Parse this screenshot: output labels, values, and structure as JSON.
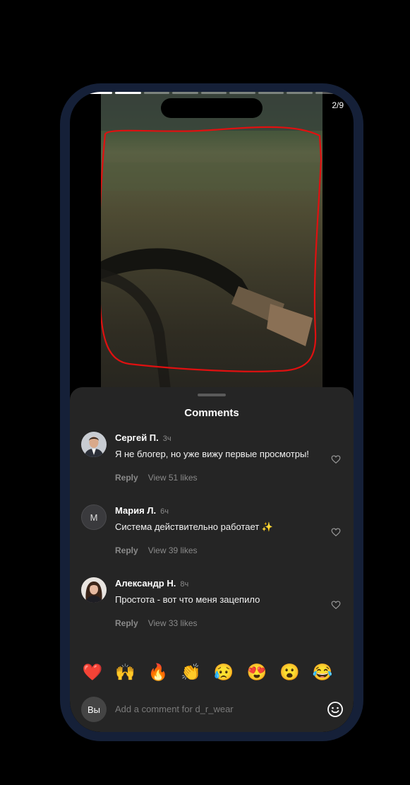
{
  "story": {
    "counter": "2/9",
    "segments": 9,
    "current": 2
  },
  "sheet": {
    "title": "Comments"
  },
  "comments": [
    {
      "name": "Сергей П.",
      "time": "3ч",
      "text": "Я не блогер, но уже вижу первые просмотры!",
      "reply": "Reply",
      "likes": "View 51 likes",
      "avatar": "man-photo"
    },
    {
      "name": "Мария Л.",
      "time": "6ч",
      "text": "Система действительно работает ✨",
      "reply": "Reply",
      "likes": "View 39 likes",
      "avatar_letter": "М"
    },
    {
      "name": "Александр Н.",
      "time": "8ч",
      "text": "Простота - вот что меня зацепило",
      "reply": "Reply",
      "likes": "View 33 likes",
      "avatar": "woman-photo"
    }
  ],
  "emojis": [
    "❤️",
    "🙌",
    "🔥",
    "👏",
    "😥",
    "😍",
    "😮",
    "😂"
  ],
  "composer": {
    "avatar": "Вы",
    "placeholder": "Add a comment for d_r_wear"
  },
  "colors": {
    "phone_frame": "#152038",
    "sheet_bg": "#252525",
    "annotation": "#e01010"
  }
}
